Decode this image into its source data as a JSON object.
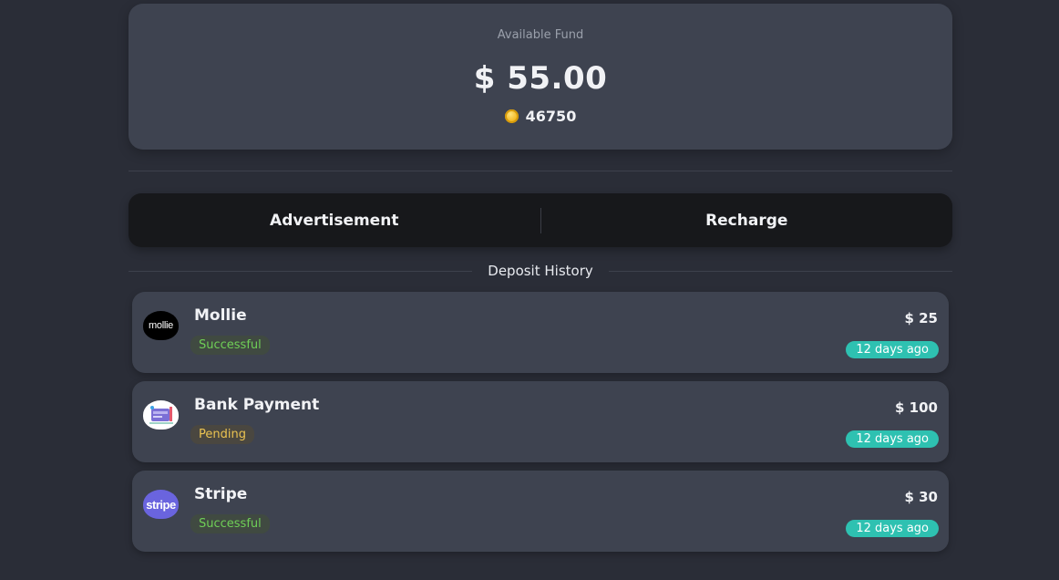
{
  "fund": {
    "label": "Available Fund",
    "amount": "$ 55.00",
    "coin_icon": "coin-icon",
    "coins": "46750"
  },
  "tabs": [
    {
      "label": "Advertisement"
    },
    {
      "label": "Recharge"
    }
  ],
  "history": {
    "title": "Deposit History",
    "items": [
      {
        "name": "Mollie",
        "status": "Successful",
        "amount": "$ 25",
        "ago": "12 days ago",
        "icon": "mollie-logo",
        "icon_text": "mollie"
      },
      {
        "name": "Bank Payment",
        "status": "Pending",
        "amount": "$ 100",
        "ago": "12 days ago",
        "icon": "bank-payment-icon"
      },
      {
        "name": "Stripe",
        "status": "Successful",
        "amount": "$ 30",
        "ago": "12 days ago",
        "icon": "stripe-logo",
        "icon_text": "stripe"
      }
    ]
  },
  "colors": {
    "background": "#2a2d37",
    "card": "#3e4350",
    "tab_bar": "#17181b",
    "success": "#6fcf57",
    "pending": "#ebc351",
    "time_badge": "#2ec1b1"
  }
}
